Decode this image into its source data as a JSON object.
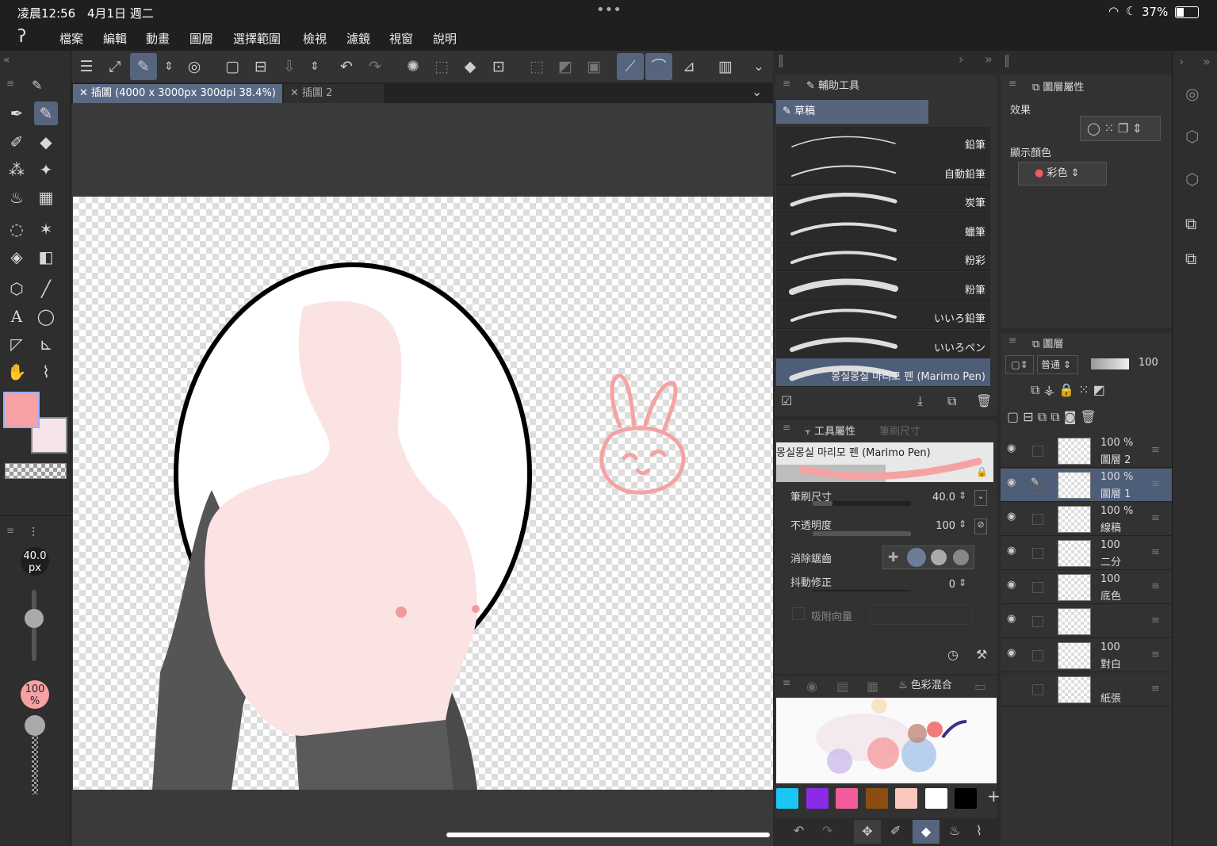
{
  "status": {
    "time": "凌晨12:56",
    "date": "4月1日 週二",
    "battery": "37%",
    "dots": "•••"
  },
  "menu": [
    "檔案",
    "編輯",
    "動畫",
    "圖層",
    "選擇範圍",
    "檢視",
    "濾鏡",
    "視窗",
    "說明"
  ],
  "tabs": {
    "active": "插圖 (4000 x 3000px 300dpi 38.4%)",
    "second": "插圖 2"
  },
  "brush": {
    "size": "40.0",
    "size_unit": "px",
    "opacity": "100",
    "opacity_unit": "%"
  },
  "subtool": {
    "title": "輔助工具",
    "group": "草稿",
    "items": [
      "鉛筆",
      "自動鉛筆",
      "炭筆",
      "蠟筆",
      "粉彩",
      "粉筆",
      "いいろ鉛筆",
      "いいろペン",
      "몽실몽실 마리모 펜 (Marimo Pen)"
    ],
    "selected_index": 8
  },
  "toolprop": {
    "title": "工具屬性",
    "tab2": "筆刷尺寸",
    "brush_name": "몽실몽실 마리모 펜 (Marimo Pen)",
    "size_label": "筆刷尺寸",
    "size_value": "40.0",
    "size_fraction": 0.2,
    "opacity_label": "不透明度",
    "opacity_value": "100",
    "opacity_fraction": 1.0,
    "aa_label": "消除鋸齒",
    "stab_label": "抖動修正",
    "stab_value": "0",
    "snap_label": "吸附向量"
  },
  "colormix": {
    "title": "色彩混合",
    "swatches": [
      "#1bc6f2",
      "#8a2be8",
      "#f25c9a",
      "#8b4d12",
      "#fbc8c0",
      "#ffffff",
      "#000000"
    ],
    "add": "+"
  },
  "layerprop": {
    "title": "圖層屬性",
    "effect_label": "效果",
    "color_label": "顯示顏色",
    "color_value": "彩色"
  },
  "layers": {
    "title": "圖層",
    "blend_mode": "普通",
    "opacity": "100",
    "rows": [
      {
        "pct": "100 %",
        "name": "圖層 2",
        "selected": false
      },
      {
        "pct": "100 %",
        "name": "圖層 1",
        "selected": true
      },
      {
        "pct": "100 %",
        "name": "線稿",
        "selected": false
      },
      {
        "pct": "100",
        "name": "二分",
        "selected": false
      },
      {
        "pct": "100",
        "name": "底色",
        "selected": false
      },
      {
        "pct": "",
        "name": "",
        "selected": false
      },
      {
        "pct": "100",
        "name": "對白",
        "selected": false
      },
      {
        "pct": "",
        "name": "紙張",
        "selected": false
      }
    ]
  },
  "colors": {
    "main": "#f7a1a4",
    "sub": "#f5e4ea",
    "accent": "#56657d"
  }
}
